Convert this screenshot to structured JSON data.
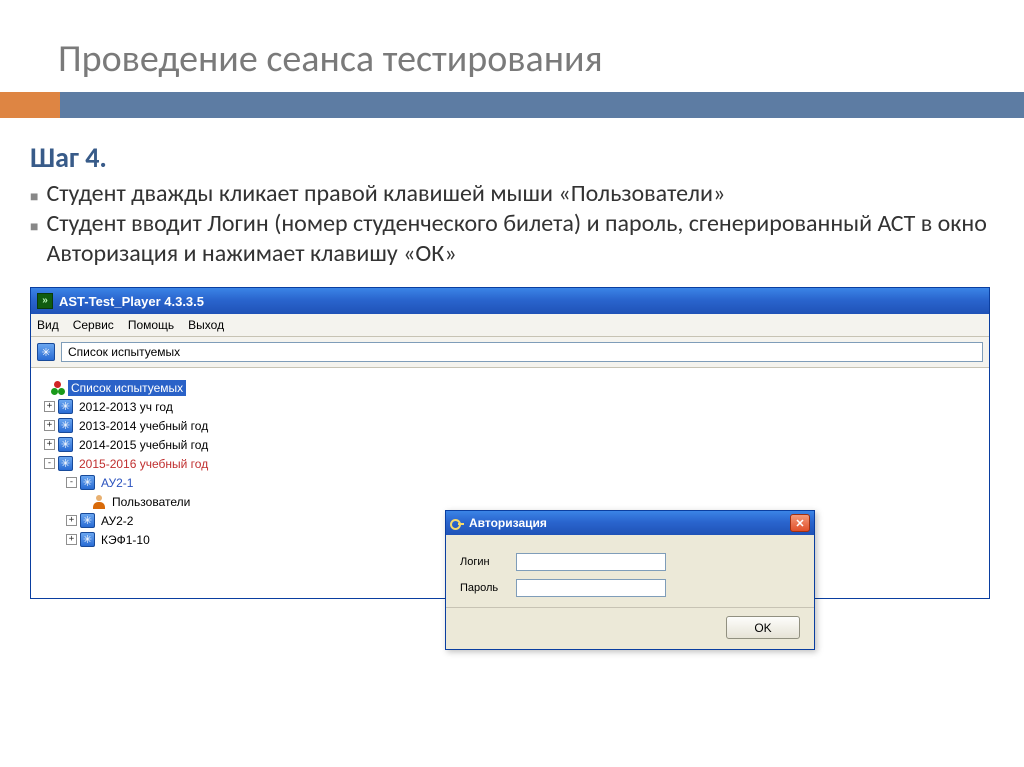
{
  "slide": {
    "title": "Проведение сеанса тестирования",
    "step_heading": "Шаг 4.",
    "bullets": [
      "Студент  дважды кликает правой клавишей мыши «Пользователи»",
      "Студент вводит Логин (номер студенческого билета) и пароль, сгенерированный АСТ в окно Авторизация и нажимает клавишу «ОК»"
    ]
  },
  "app_window": {
    "title": "AST-Test_Player  4.3.3.5",
    "icon_glyph": "»",
    "menu": [
      "Вид",
      "Сервис",
      "Помощь",
      "Выход"
    ],
    "toolbar_icon_glyph": "✳",
    "path_text": "Список испытуемых",
    "tree": {
      "root": "Список испытуемых",
      "nodes": [
        {
          "expand": "+",
          "label": "2012-2013 уч год",
          "cls": ""
        },
        {
          "expand": "+",
          "label": "2013-2014 учебный год",
          "cls": ""
        },
        {
          "expand": "+",
          "label": "2014-2015 учебный год",
          "cls": ""
        },
        {
          "expand": "-",
          "label": "2015-2016 учебный год",
          "cls": "node-red"
        }
      ],
      "sub": {
        "group_open": {
          "expand": "-",
          "label": "АУ2-1",
          "cls": "node-blue"
        },
        "users_label": "Пользователи",
        "siblings": [
          {
            "expand": "+",
            "label": "АУ2-2",
            "cls": ""
          },
          {
            "expand": "+",
            "label": "КЭФ1-10",
            "cls": ""
          }
        ]
      }
    }
  },
  "auth_dialog": {
    "title": "Авторизация",
    "login_label": "Логин",
    "password_label": "Пароль",
    "ok_label": "OK",
    "close_glyph": "✕"
  }
}
